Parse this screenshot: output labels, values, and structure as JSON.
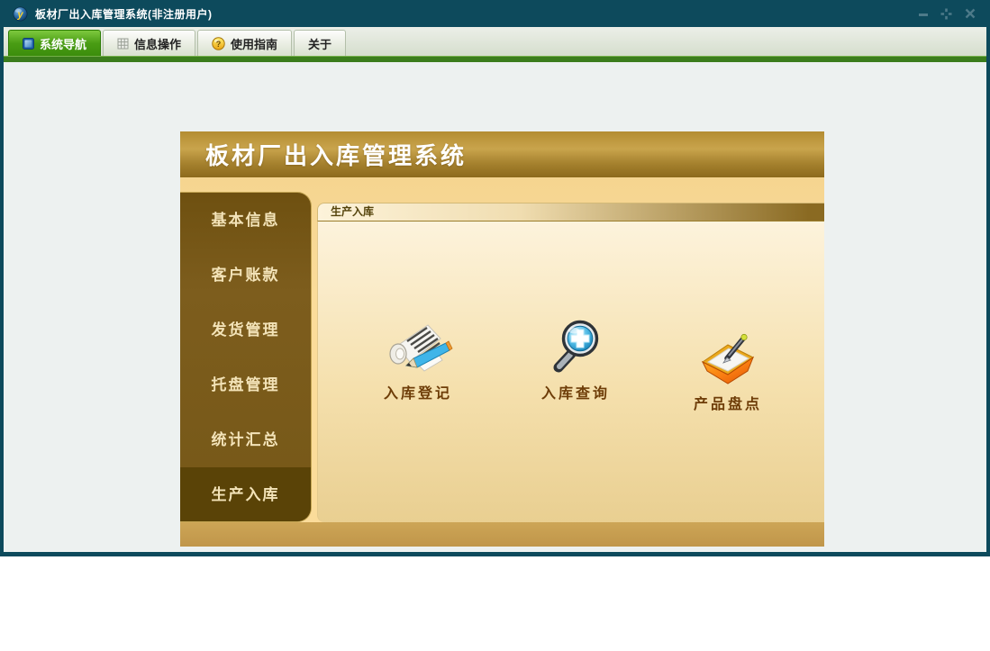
{
  "window": {
    "title": "板材厂出入库管理系统(非注册用户)",
    "app_icon_letter": "y"
  },
  "tabs": [
    {
      "label": "系统导航",
      "icon": "nav-square-icon",
      "active": true
    },
    {
      "label": "信息操作",
      "icon": "grid-icon",
      "active": false
    },
    {
      "label": "使用指南",
      "icon": "help-icon",
      "glyph": "?",
      "active": false
    },
    {
      "label": "关于",
      "icon": "none",
      "active": false
    }
  ],
  "panel": {
    "title": "板材厂出入库管理系统",
    "sidebar": {
      "items": [
        "基本信息",
        "客户账款",
        "发货管理",
        "托盘管理",
        "统计汇总",
        "生产入库"
      ],
      "selected": "生产入库"
    },
    "groupbox": {
      "title": "生产入库"
    },
    "shortcuts": [
      {
        "label": "入库登记",
        "icon": "register-scroll-icon"
      },
      {
        "label": "入库查询",
        "icon": "search-magnifier-icon"
      },
      {
        "label": "产品盘点",
        "icon": "inventory-folder-icon"
      }
    ]
  },
  "colors": {
    "titlebar": "#0d4a5c",
    "window_border": "#0d4a5c",
    "active_tab_green": "#4a9d14",
    "accent_green_bar": "#3b7d1c",
    "panel_header_gold": "#c9a44c",
    "sidebar_brown": "#77591a",
    "sidebar_selected": "#5a4307",
    "content_cream": "#fdf3dc",
    "footer_gold": "#c79f4e",
    "shortcut_label": "#6e3d08"
  }
}
